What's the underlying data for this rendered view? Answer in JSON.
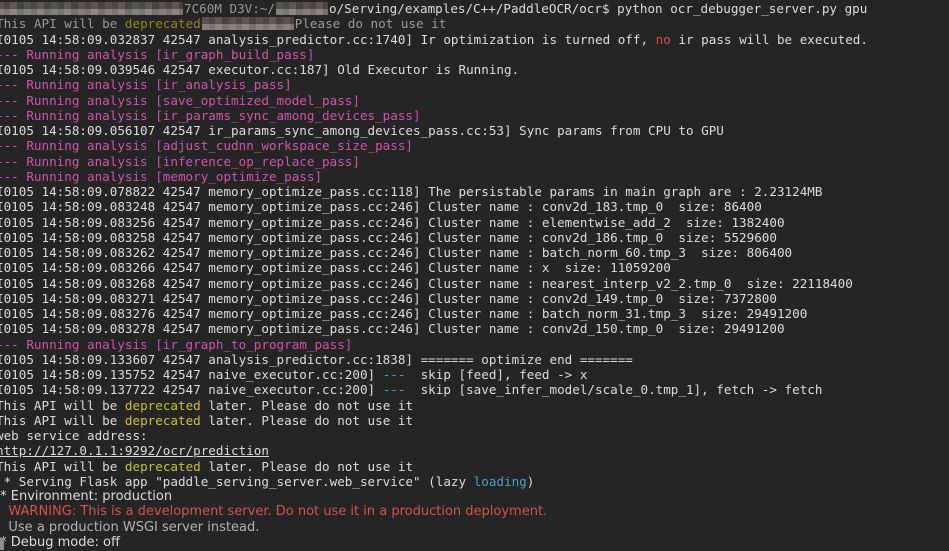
{
  "colors": {
    "bg": "#252525",
    "fg": "#dcdcdc",
    "dim": "#9a9a9a",
    "mag": "#d153ab",
    "yel": "#c8c22f",
    "yeld": "#8c8a1d",
    "red": "#d94f4f",
    "cyan": "#45a3c4",
    "gray": "#b3b3b3",
    "link": "#dcdcdc",
    "cursor": "#8f8f8f"
  },
  "terminal": {
    "cursor_visible": true,
    "lines": [
      {
        "name": "shell-prompt-line",
        "segments": [
          {
            "redact": 186
          },
          {
            "t": "7C60M D3V:~/",
            "c": "dim"
          },
          {
            "redact": 52
          },
          {
            "t": "o/Serving/examples/C++/PaddleOCR/ocr$ python ocr_debugger_server.py gpu",
            "c": "fg",
            "name": "shell-command"
          }
        ]
      },
      {
        "segments": [
          {
            "t": "This API will be ",
            "c": "dim"
          },
          {
            "t": "deprecated",
            "c": "yeld"
          },
          {
            "redact": 92
          },
          {
            "t": "Please do not use it",
            "c": "dim"
          }
        ]
      },
      {
        "segments": [
          {
            "t": "I0105 14:58:09.032837 42547 analysis_predictor.cc:1740] Ir optimization is turned off, ",
            "c": "fg"
          },
          {
            "t": "no",
            "c": "red"
          },
          {
            "t": " ir pass will be executed.",
            "c": "fg"
          }
        ]
      },
      {
        "segments": [
          {
            "t": "--- Running analysis [ir_graph_build_pass]",
            "c": "mag"
          }
        ]
      },
      {
        "segments": [
          {
            "t": "I0105 14:58:09.039546 42547 executor.cc:187] Old Executor is Running.",
            "c": "fg"
          }
        ]
      },
      {
        "segments": [
          {
            "t": "--- Running analysis [ir_analysis_pass]",
            "c": "mag"
          }
        ]
      },
      {
        "segments": [
          {
            "t": "--- Running analysis [save_optimized_model_pass]",
            "c": "mag"
          }
        ]
      },
      {
        "segments": [
          {
            "t": "--- Running analysis [ir_params_sync_among_devices_pass]",
            "c": "mag"
          }
        ]
      },
      {
        "segments": [
          {
            "t": "I0105 14:58:09.056107 42547 ir_params_sync_among_devices_pass.cc:53] Sync params from CPU to GPU",
            "c": "fg"
          }
        ]
      },
      {
        "segments": [
          {
            "t": "--- Running analysis [adjust_cudnn_workspace_size_pass]",
            "c": "mag"
          }
        ]
      },
      {
        "segments": [
          {
            "t": "--- Running analysis [inference_op_replace_pass]",
            "c": "mag"
          }
        ]
      },
      {
        "segments": [
          {
            "t": "--- Running analysis [memory_optimize_pass]",
            "c": "mag"
          }
        ]
      },
      {
        "segments": [
          {
            "t": "I0105 14:58:09.078822 42547 memory_optimize_pass.cc:118] The persistable params in main graph are : 2.23124MB",
            "c": "fg"
          }
        ]
      },
      {
        "segments": [
          {
            "t": "I0105 14:58:09.083248 42547 memory_optimize_pass.cc:246] Cluster name : conv2d_183.tmp_0  size: 86400",
            "c": "fg"
          }
        ]
      },
      {
        "segments": [
          {
            "t": "I0105 14:58:09.083256 42547 memory_optimize_pass.cc:246] Cluster name : elementwise_add_2  size: 1382400",
            "c": "fg"
          }
        ]
      },
      {
        "segments": [
          {
            "t": "I0105 14:58:09.083258 42547 memory_optimize_pass.cc:246] Cluster name : conv2d_186.tmp_0  size: 5529600",
            "c": "fg"
          }
        ]
      },
      {
        "segments": [
          {
            "t": "I0105 14:58:09.083262 42547 memory_optimize_pass.cc:246] Cluster name : batch_norm_60.tmp_3  size: 806400",
            "c": "fg"
          }
        ]
      },
      {
        "segments": [
          {
            "t": "I0105 14:58:09.083266 42547 memory_optimize_pass.cc:246] Cluster name : x  size: 11059200",
            "c": "fg"
          }
        ]
      },
      {
        "segments": [
          {
            "t": "I0105 14:58:09.083268 42547 memory_optimize_pass.cc:246] Cluster name : nearest_interp_v2_2.tmp_0  size: 22118400",
            "c": "fg"
          }
        ]
      },
      {
        "segments": [
          {
            "t": "I0105 14:58:09.083271 42547 memory_optimize_pass.cc:246] Cluster name : conv2d_149.tmp_0  size: 7372800",
            "c": "fg"
          }
        ]
      },
      {
        "segments": [
          {
            "t": "I0105 14:58:09.083276 42547 memory_optimize_pass.cc:246] Cluster name : batch_norm_31.tmp_3  size: 29491200",
            "c": "fg"
          }
        ]
      },
      {
        "segments": [
          {
            "t": "I0105 14:58:09.083278 42547 memory_optimize_pass.cc:246] Cluster name : conv2d_150.tmp_0  size: 29491200",
            "c": "fg"
          }
        ]
      },
      {
        "segments": [
          {
            "t": "--- Running analysis [ir_graph_to_program_pass]",
            "c": "mag"
          }
        ]
      },
      {
        "segments": [
          {
            "t": "I0105 14:58:09.133607 42547 analysis_predictor.cc:1838] ======= optimize end =======",
            "c": "fg"
          }
        ]
      },
      {
        "segments": [
          {
            "t": "I0105 14:58:09.135752 42547 naive_executor.cc:200] ",
            "c": "fg"
          },
          {
            "t": "---",
            "c": "cyan"
          },
          {
            "t": "  skip [feed], feed -> x",
            "c": "fg"
          }
        ]
      },
      {
        "segments": [
          {
            "t": "I0105 14:58:09.137722 42547 naive_executor.cc:200] ",
            "c": "fg"
          },
          {
            "t": "---",
            "c": "cyan"
          },
          {
            "t": "  skip [save_infer_model/scale_0.tmp_1], fetch -> fetch",
            "c": "fg"
          }
        ]
      },
      {
        "segments": [
          {
            "t": "This API will be ",
            "c": "fg"
          },
          {
            "t": "deprecated",
            "c": "yel"
          },
          {
            "t": " later. Please do not use it",
            "c": "fg"
          }
        ]
      },
      {
        "segments": [
          {
            "t": "This API will be ",
            "c": "fg"
          },
          {
            "t": "deprecated",
            "c": "yel"
          },
          {
            "t": " later. Please do not use it",
            "c": "fg"
          }
        ]
      },
      {
        "segments": [
          {
            "t": "web service address:",
            "c": "fg"
          }
        ]
      },
      {
        "segments": [
          {
            "t": "http://127.0.1.1:9292/ocr/prediction",
            "c": "link",
            "name": "web-service-url"
          }
        ]
      },
      {
        "segments": [
          {
            "t": "This API will be ",
            "c": "fg"
          },
          {
            "t": "deprecated",
            "c": "yel"
          },
          {
            "t": " later. Please do not use it",
            "c": "fg"
          }
        ]
      },
      {
        "segments": [
          {
            "t": " * Serving Flask app \"paddle_serving_server.web_service\" (lazy ",
            "c": "fg"
          },
          {
            "t": "loading",
            "c": "cyan"
          },
          {
            "t": ")",
            "c": "fg"
          }
        ]
      },
      {
        "font": "sans",
        "segments": [
          {
            "t": " * Environment: production",
            "c": "fg"
          }
        ]
      },
      {
        "font": "sans",
        "segments": [
          {
            "t": "   WARNING: This is a development server. Do not use it in a production deployment.",
            "c": "red"
          }
        ]
      },
      {
        "font": "sans",
        "segments": [
          {
            "t": "   Use a production WSGI server instead.",
            "c": "gray"
          }
        ]
      },
      {
        "font": "sans",
        "segments": [
          {
            "t": " * Debug mode: off",
            "c": "fg"
          }
        ]
      }
    ]
  }
}
